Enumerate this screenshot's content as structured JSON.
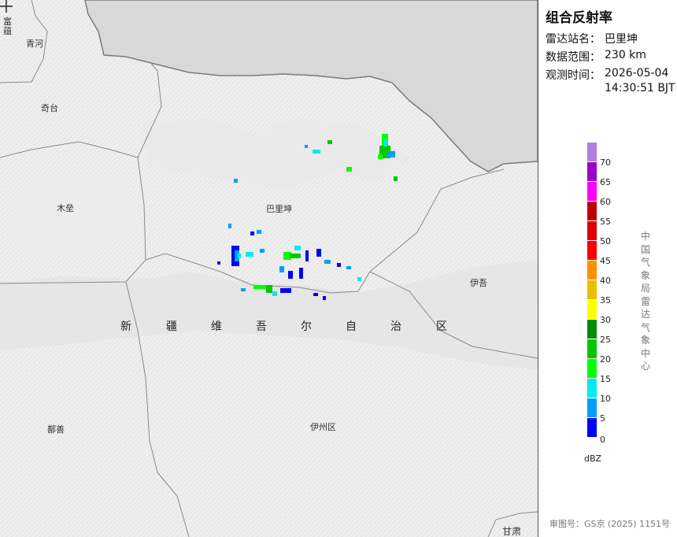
{
  "panel": {
    "title": "组合反射率",
    "station_label": "雷达站名：",
    "station_value": "巴里坤",
    "range_label": "数据范围：",
    "range_value": "230 km",
    "time_label": "观测时间：",
    "time_date": "2026-05-04",
    "time_clock": "14:30:51 BJT",
    "vertical_text": "中国气象局雷达气象中心",
    "review_number": "审图号：GS京 (2025) 1151号"
  },
  "legend": {
    "unit": "dBZ",
    "ticks": [
      "70",
      "65",
      "60",
      "55",
      "50",
      "45",
      "40",
      "35",
      "30",
      "25",
      "20",
      "15",
      "10",
      "5",
      "0"
    ],
    "colors": [
      "#b07ee0",
      "#9c00c8",
      "#ff00ff",
      "#c00000",
      "#e00000",
      "#ff0000",
      "#ff9000",
      "#e7c000",
      "#ffff00",
      "#008e00",
      "#00c800",
      "#00ff00",
      "#00ecec",
      "#00a0f6",
      "#0000f6"
    ]
  },
  "map": {
    "places": {
      "fuyun": "富\n蕴",
      "qinghe": "青河",
      "qitai": "奇台",
      "mulei": "木垒",
      "balikun": "巴里坤",
      "yiwu": "伊吾",
      "shanshan": "鄯善",
      "yizhou": "伊州区",
      "gansu": "甘肃"
    },
    "region_chars": [
      "新",
      "疆",
      "维",
      "吾",
      "尔",
      "自",
      "治",
      "区"
    ],
    "colors": {
      "mongolia": "#d8d8d8",
      "border": "#7a7a7a",
      "land": "#f0f0f0"
    }
  }
}
